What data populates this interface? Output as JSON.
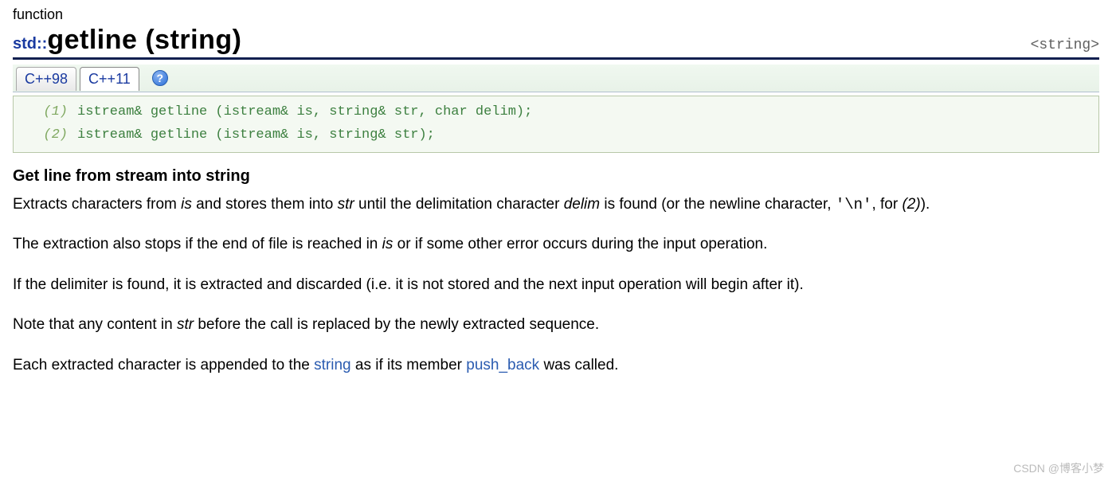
{
  "category": "function",
  "header_include": "<string>",
  "namespace": "std::",
  "title": "getline (string)",
  "tabs": {
    "cpp98": "C++98",
    "cpp11": "C++11"
  },
  "help_icon_label": "?",
  "signatures": [
    {
      "num": "(1)",
      "code": "istream& getline (istream& is, string& str, char delim);"
    },
    {
      "num": "(2)",
      "code": "istream& getline (istream& is, string& str);"
    }
  ],
  "section_title": "Get line from stream into string",
  "para1": {
    "t1": "Extracts characters from ",
    "is": "is",
    "t2": " and stores them into ",
    "str": "str",
    "t3": " until the delimitation character ",
    "delim": "delim",
    "t4": " is found (or the newline character, ",
    "nl": "'\\n'",
    "t5": ", for ",
    "two": "(2)",
    "t6": ")."
  },
  "para2": {
    "t1": "The extraction also stops if the end of file is reached in ",
    "is": "is",
    "t2": " or if some other error occurs during the input operation."
  },
  "para3": "If the delimiter is found, it is extracted and discarded (i.e. it is not stored and the next input operation will begin after it).",
  "para4": {
    "t1": "Note that any content in ",
    "str": "str",
    "t2": " before the call is replaced by the newly extracted sequence."
  },
  "para5": {
    "t1": "Each extracted character is appended to the ",
    "link1": "string",
    "t2": " as if its member ",
    "link2": "push_back",
    "t3": " was called."
  },
  "watermark": "CSDN @博客小梦"
}
